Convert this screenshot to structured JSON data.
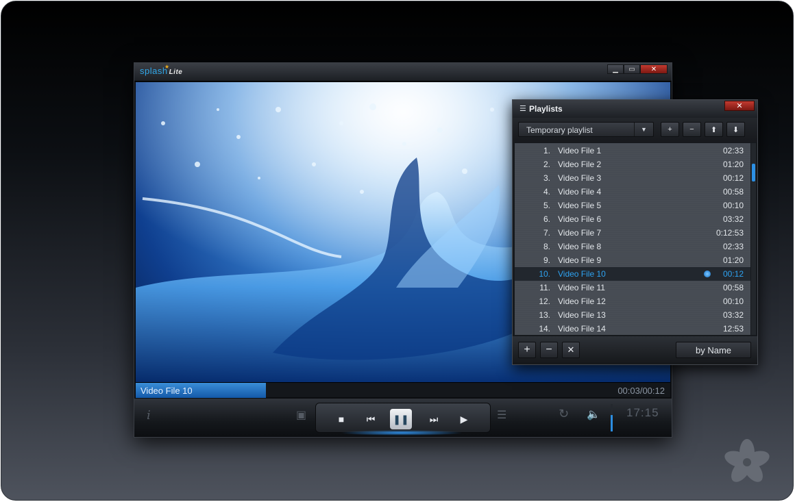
{
  "app": {
    "logo_text": "splash",
    "logo_edition": "Lite",
    "window_buttons": {
      "minimize": "▁",
      "maximize": "▭",
      "close": "✕"
    }
  },
  "now_playing": {
    "title": "Video File 10",
    "time": "00:03/00:12",
    "progress_fraction": 0.244
  },
  "controls": {
    "clock": "17:15",
    "info": "i",
    "volume_fraction": 0.6,
    "icons": [
      "info-icon",
      "snapshot-icon",
      "stop-icon",
      "previous-icon",
      "pause-icon",
      "next-icon",
      "frame-step-icon",
      "playlist-icon",
      "repeat-icon",
      "volume-icon"
    ]
  },
  "playlist": {
    "title": "Playlists",
    "close": "✕",
    "selected_playlist": "Temporary playlist",
    "sort_label": "by Name",
    "items": [
      {
        "num": "1.",
        "name": "Video File 1",
        "duration": "02:33"
      },
      {
        "num": "2.",
        "name": "Video File 2",
        "duration": "01:20"
      },
      {
        "num": "3.",
        "name": "Video File 3",
        "duration": "00:12"
      },
      {
        "num": "4.",
        "name": "Video File 4",
        "duration": "00:58"
      },
      {
        "num": "5.",
        "name": "Video File 5",
        "duration": "00:10"
      },
      {
        "num": "6.",
        "name": "Video File 6",
        "duration": "03:32"
      },
      {
        "num": "7.",
        "name": "Video File 7",
        "duration": "0:12:53"
      },
      {
        "num": "8.",
        "name": "Video File 8",
        "duration": "02:33"
      },
      {
        "num": "9.",
        "name": "Video File  9",
        "duration": "01:20"
      },
      {
        "num": "10.",
        "name": "Video File 10",
        "duration": "00:12"
      },
      {
        "num": "11.",
        "name": "Video File 11",
        "duration": "00:58"
      },
      {
        "num": "12.",
        "name": "Video File 12",
        "duration": "00:10"
      },
      {
        "num": "13.",
        "name": "Video File 13",
        "duration": "03:32"
      },
      {
        "num": "14.",
        "name": "Video File 14",
        "duration": "12:53"
      }
    ],
    "active_index": 9
  },
  "colors": {
    "accent": "#2ea3f2",
    "close_red": "#c23a30"
  }
}
